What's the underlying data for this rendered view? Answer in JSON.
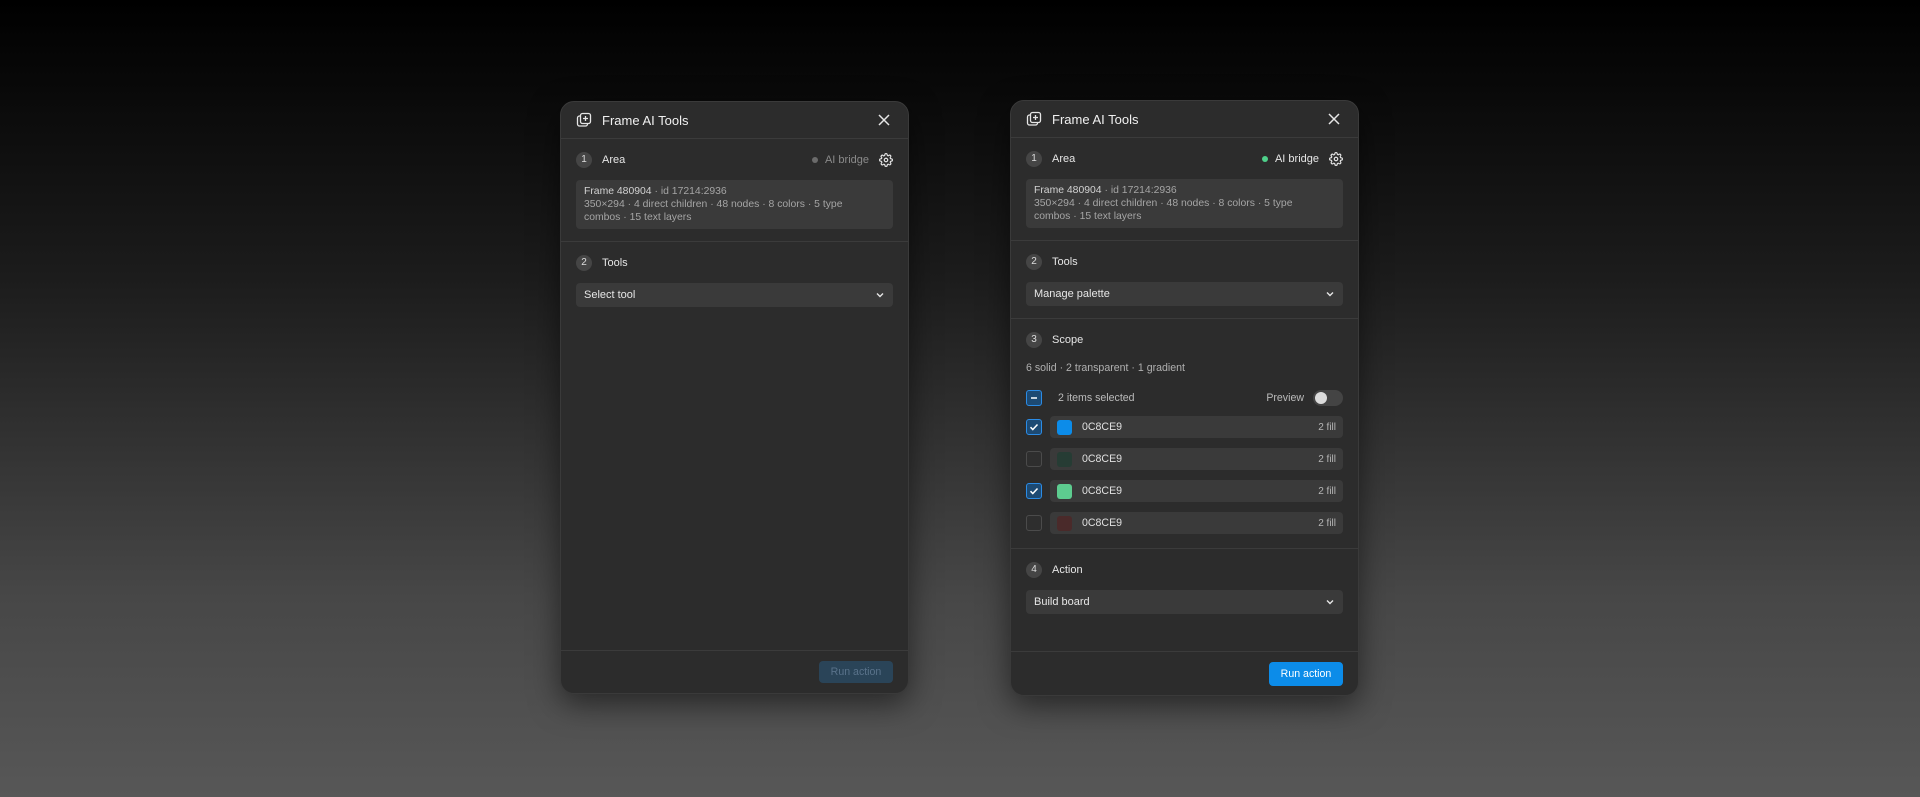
{
  "left_panel": {
    "title": "Frame AI Tools",
    "area": {
      "number": "1",
      "label": "Area",
      "bridge_label": "AI bridge",
      "bridge_status_color": "#6b6b6b",
      "frame_name": "Frame 480904",
      "frame_id": "id 17214:2936",
      "frame_details_line2": "350×294 · 4 direct children · 48 nodes · 8 colors · 5 type",
      "frame_details_line3": "combos · 15 text layers"
    },
    "tools": {
      "number": "2",
      "label": "Tools",
      "select_value": "Select tool"
    },
    "run_label": "Run action"
  },
  "right_panel": {
    "title": "Frame AI Tools",
    "area": {
      "number": "1",
      "label": "Area",
      "bridge_label": "AI bridge",
      "bridge_status_color": "#4ed08a",
      "frame_name": "Frame 480904",
      "frame_id": "id 17214:2936",
      "frame_details_line2": "350×294 · 4 direct children · 48 nodes · 8 colors · 5 type",
      "frame_details_line3": "combos · 15 text layers"
    },
    "tools": {
      "number": "2",
      "label": "Tools",
      "select_value": "Manage palette"
    },
    "scope": {
      "number": "3",
      "label": "Scope",
      "summary": "6 solid · 2 transparent · 1 gradient",
      "selected_text": "2 items selected",
      "preview_label": "Preview",
      "preview_on": false,
      "colors": [
        {
          "hex": "0C8CE9",
          "swatch": "#0c8ce9",
          "count": "2 fill",
          "checked": true
        },
        {
          "hex": "0C8CE9",
          "swatch": "#263c34",
          "count": "2 fill",
          "checked": false
        },
        {
          "hex": "0C8CE9",
          "swatch": "#5dcc8f",
          "count": "2 fill",
          "checked": true
        },
        {
          "hex": "0C8CE9",
          "swatch": "#4a2a2a",
          "count": "2 fill",
          "checked": false
        }
      ]
    },
    "action": {
      "number": "4",
      "label": "Action",
      "select_value": "Build board"
    },
    "run_label": "Run action"
  },
  "colors": {
    "accent": "#0c8ce9",
    "panel_bg": "#2c2c2c",
    "field_bg": "#3a3a3a"
  }
}
